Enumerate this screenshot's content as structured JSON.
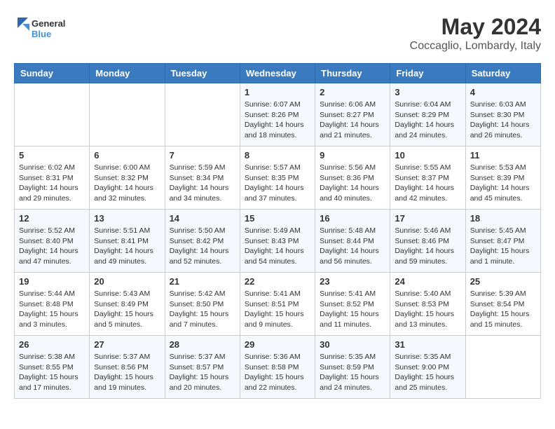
{
  "logo": {
    "text_general": "General",
    "text_blue": "Blue"
  },
  "title": {
    "month_year": "May 2024",
    "location": "Coccaglio, Lombardy, Italy"
  },
  "days_of_week": [
    "Sunday",
    "Monday",
    "Tuesday",
    "Wednesday",
    "Thursday",
    "Friday",
    "Saturday"
  ],
  "weeks": [
    [
      {
        "day": "",
        "info": ""
      },
      {
        "day": "",
        "info": ""
      },
      {
        "day": "",
        "info": ""
      },
      {
        "day": "1",
        "info": "Sunrise: 6:07 AM\nSunset: 8:26 PM\nDaylight: 14 hours and 18 minutes."
      },
      {
        "day": "2",
        "info": "Sunrise: 6:06 AM\nSunset: 8:27 PM\nDaylight: 14 hours and 21 minutes."
      },
      {
        "day": "3",
        "info": "Sunrise: 6:04 AM\nSunset: 8:29 PM\nDaylight: 14 hours and 24 minutes."
      },
      {
        "day": "4",
        "info": "Sunrise: 6:03 AM\nSunset: 8:30 PM\nDaylight: 14 hours and 26 minutes."
      }
    ],
    [
      {
        "day": "5",
        "info": "Sunrise: 6:02 AM\nSunset: 8:31 PM\nDaylight: 14 hours and 29 minutes."
      },
      {
        "day": "6",
        "info": "Sunrise: 6:00 AM\nSunset: 8:32 PM\nDaylight: 14 hours and 32 minutes."
      },
      {
        "day": "7",
        "info": "Sunrise: 5:59 AM\nSunset: 8:34 PM\nDaylight: 14 hours and 34 minutes."
      },
      {
        "day": "8",
        "info": "Sunrise: 5:57 AM\nSunset: 8:35 PM\nDaylight: 14 hours and 37 minutes."
      },
      {
        "day": "9",
        "info": "Sunrise: 5:56 AM\nSunset: 8:36 PM\nDaylight: 14 hours and 40 minutes."
      },
      {
        "day": "10",
        "info": "Sunrise: 5:55 AM\nSunset: 8:37 PM\nDaylight: 14 hours and 42 minutes."
      },
      {
        "day": "11",
        "info": "Sunrise: 5:53 AM\nSunset: 8:39 PM\nDaylight: 14 hours and 45 minutes."
      }
    ],
    [
      {
        "day": "12",
        "info": "Sunrise: 5:52 AM\nSunset: 8:40 PM\nDaylight: 14 hours and 47 minutes."
      },
      {
        "day": "13",
        "info": "Sunrise: 5:51 AM\nSunset: 8:41 PM\nDaylight: 14 hours and 49 minutes."
      },
      {
        "day": "14",
        "info": "Sunrise: 5:50 AM\nSunset: 8:42 PM\nDaylight: 14 hours and 52 minutes."
      },
      {
        "day": "15",
        "info": "Sunrise: 5:49 AM\nSunset: 8:43 PM\nDaylight: 14 hours and 54 minutes."
      },
      {
        "day": "16",
        "info": "Sunrise: 5:48 AM\nSunset: 8:44 PM\nDaylight: 14 hours and 56 minutes."
      },
      {
        "day": "17",
        "info": "Sunrise: 5:46 AM\nSunset: 8:46 PM\nDaylight: 14 hours and 59 minutes."
      },
      {
        "day": "18",
        "info": "Sunrise: 5:45 AM\nSunset: 8:47 PM\nDaylight: 15 hours and 1 minute."
      }
    ],
    [
      {
        "day": "19",
        "info": "Sunrise: 5:44 AM\nSunset: 8:48 PM\nDaylight: 15 hours and 3 minutes."
      },
      {
        "day": "20",
        "info": "Sunrise: 5:43 AM\nSunset: 8:49 PM\nDaylight: 15 hours and 5 minutes."
      },
      {
        "day": "21",
        "info": "Sunrise: 5:42 AM\nSunset: 8:50 PM\nDaylight: 15 hours and 7 minutes."
      },
      {
        "day": "22",
        "info": "Sunrise: 5:41 AM\nSunset: 8:51 PM\nDaylight: 15 hours and 9 minutes."
      },
      {
        "day": "23",
        "info": "Sunrise: 5:41 AM\nSunset: 8:52 PM\nDaylight: 15 hours and 11 minutes."
      },
      {
        "day": "24",
        "info": "Sunrise: 5:40 AM\nSunset: 8:53 PM\nDaylight: 15 hours and 13 minutes."
      },
      {
        "day": "25",
        "info": "Sunrise: 5:39 AM\nSunset: 8:54 PM\nDaylight: 15 hours and 15 minutes."
      }
    ],
    [
      {
        "day": "26",
        "info": "Sunrise: 5:38 AM\nSunset: 8:55 PM\nDaylight: 15 hours and 17 minutes."
      },
      {
        "day": "27",
        "info": "Sunrise: 5:37 AM\nSunset: 8:56 PM\nDaylight: 15 hours and 19 minutes."
      },
      {
        "day": "28",
        "info": "Sunrise: 5:37 AM\nSunset: 8:57 PM\nDaylight: 15 hours and 20 minutes."
      },
      {
        "day": "29",
        "info": "Sunrise: 5:36 AM\nSunset: 8:58 PM\nDaylight: 15 hours and 22 minutes."
      },
      {
        "day": "30",
        "info": "Sunrise: 5:35 AM\nSunset: 8:59 PM\nDaylight: 15 hours and 24 minutes."
      },
      {
        "day": "31",
        "info": "Sunrise: 5:35 AM\nSunset: 9:00 PM\nDaylight: 15 hours and 25 minutes."
      },
      {
        "day": "",
        "info": ""
      }
    ]
  ]
}
